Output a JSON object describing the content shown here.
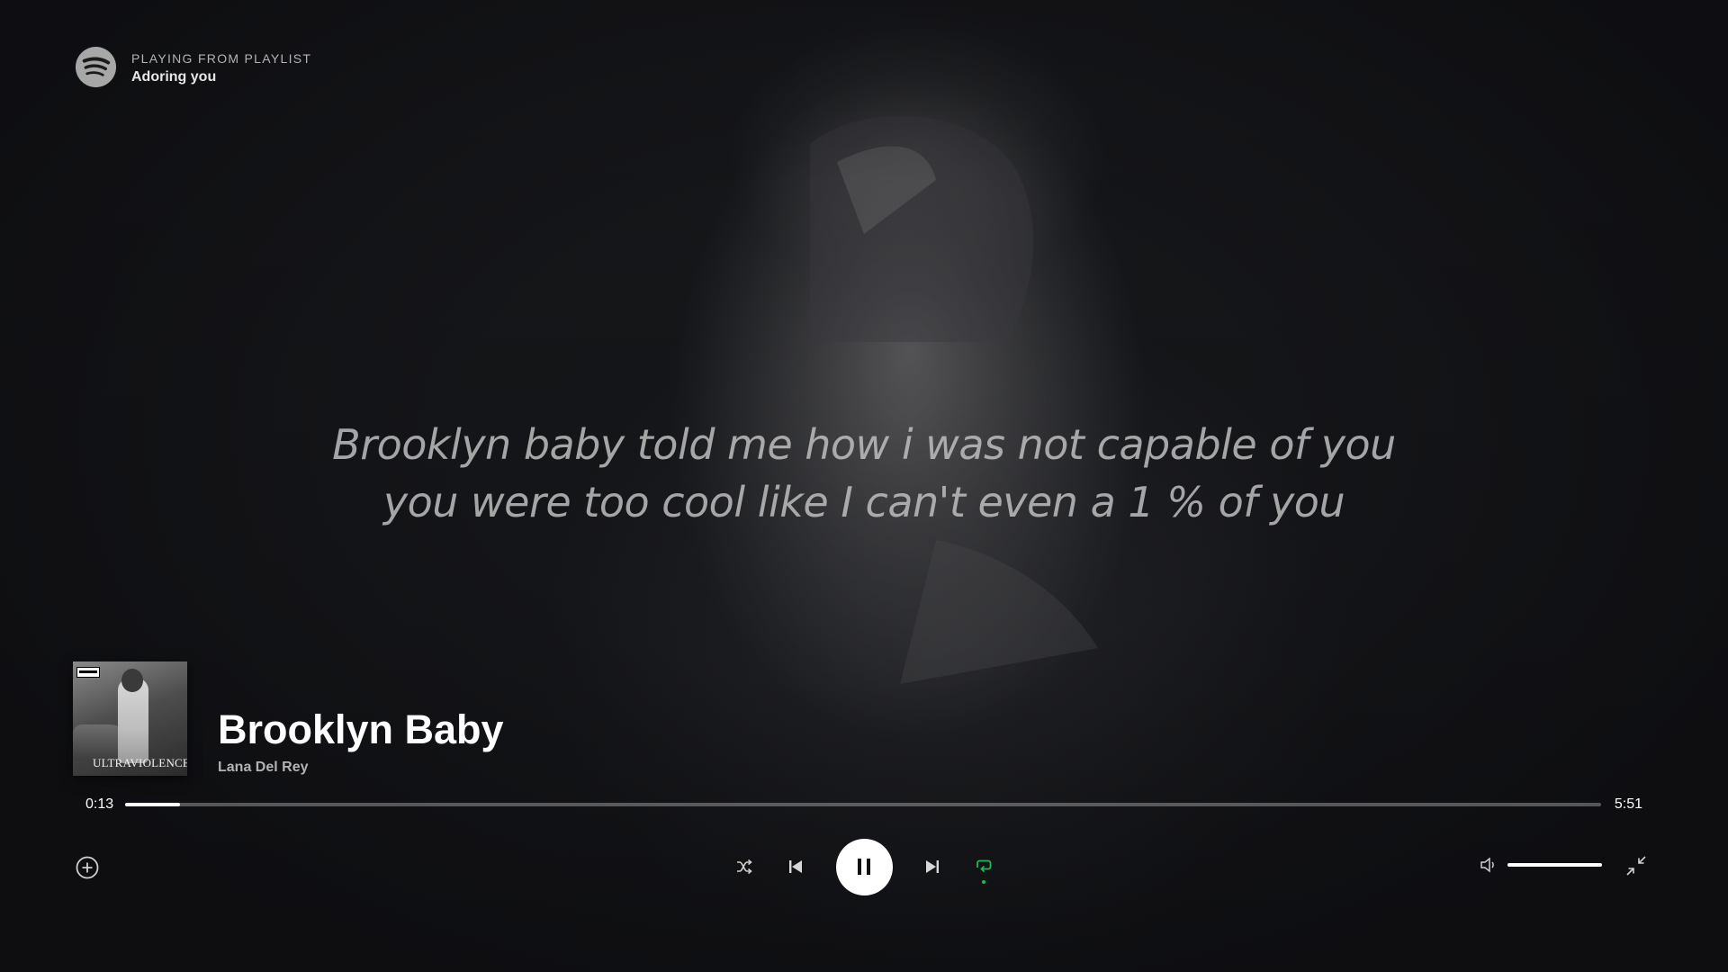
{
  "header": {
    "playing_from_label": "PLAYING FROM PLAYLIST",
    "playlist_name": "Adoring you"
  },
  "lyrics": {
    "line1": "Brooklyn baby told me how i was not capable of you",
    "line2": "you were too cool like I can't even a 1 % of you"
  },
  "track": {
    "title": "Brooklyn Baby",
    "artist": "Lana Del Rey",
    "cover_text": "ULTRAVIOLENCE"
  },
  "playback": {
    "elapsed": "0:13",
    "duration": "5:51",
    "progress_fraction": 0.037,
    "volume_fraction": 1.0,
    "repeat_active": true
  },
  "icons": {
    "logo": "spotify-logo",
    "add": "plus-circle-icon",
    "shuffle": "shuffle-icon",
    "previous": "skip-back-icon",
    "pause": "pause-icon",
    "next": "skip-forward-icon",
    "repeat": "repeat-icon",
    "volume": "volume-icon",
    "minimize": "minimize-icon"
  },
  "colors": {
    "accent": "#1db954",
    "background": "#121316",
    "text_secondary": "#b3b3b3"
  }
}
